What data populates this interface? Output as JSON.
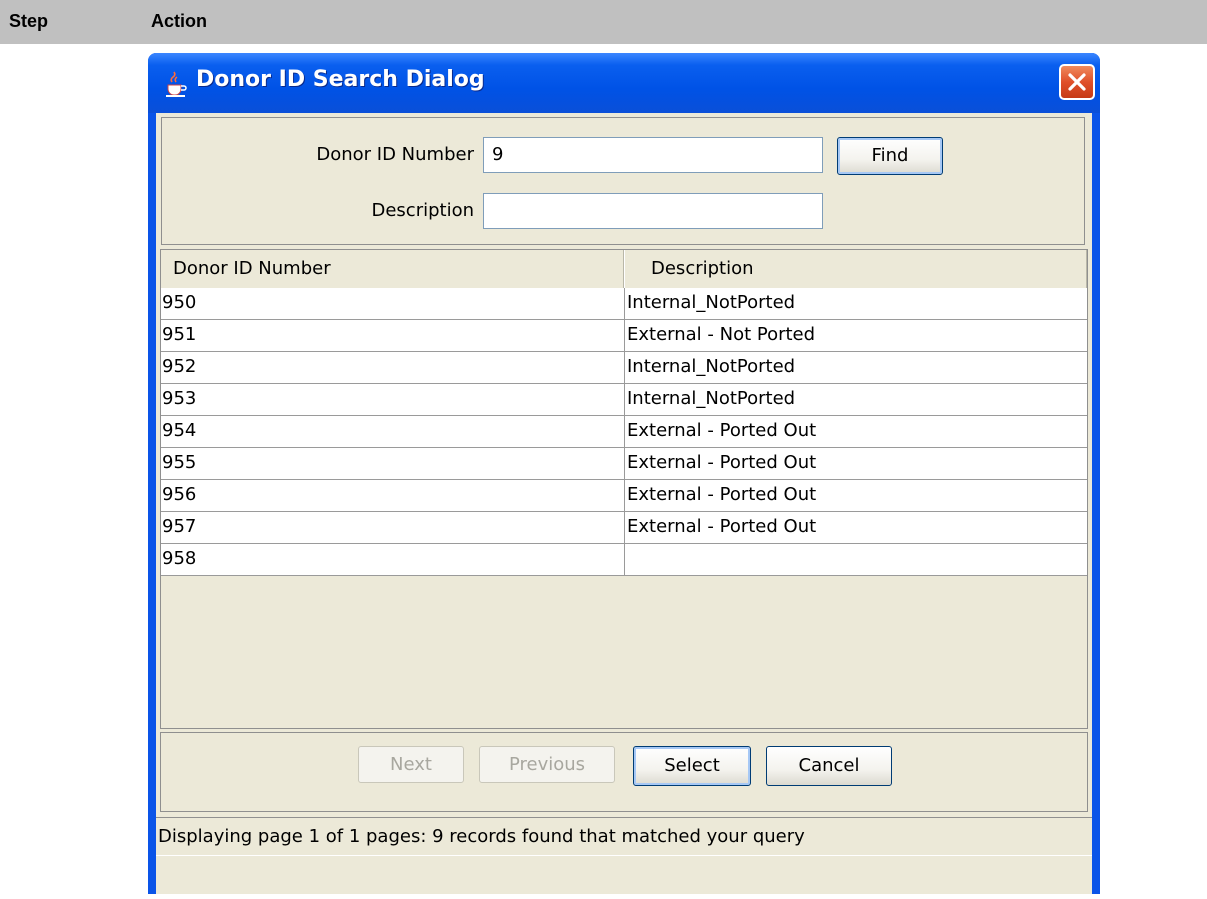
{
  "doc_header": {
    "step": "Step",
    "action": "Action"
  },
  "dialog": {
    "title": "Donor ID Search Dialog",
    "icon": "java-cup-icon",
    "close_icon": "close-icon"
  },
  "search": {
    "donor_label": "Donor ID Number",
    "donor_value": "9",
    "description_label": "Description",
    "description_value": "",
    "find_label": "Find"
  },
  "table": {
    "columns": [
      "Donor ID Number",
      "Description"
    ],
    "rows": [
      [
        "950",
        "Internal_NotPorted"
      ],
      [
        "951",
        "External - Not Ported"
      ],
      [
        "952",
        "Internal_NotPorted"
      ],
      [
        "953",
        "Internal_NotPorted"
      ],
      [
        "954",
        "External - Ported Out"
      ],
      [
        "955",
        "External - Ported Out"
      ],
      [
        "956",
        "External - Ported Out"
      ],
      [
        "957",
        "External - Ported Out"
      ],
      [
        "958",
        ""
      ]
    ]
  },
  "buttons": {
    "next": "Next",
    "previous": "Previous",
    "select": "Select",
    "cancel": "Cancel"
  },
  "status": "Displaying page 1 of 1 pages:   9 records found that matched your query",
  "colors": {
    "title_bar": "#0a54e8",
    "panel": "#ece9d8",
    "close": "#e0502a"
  }
}
